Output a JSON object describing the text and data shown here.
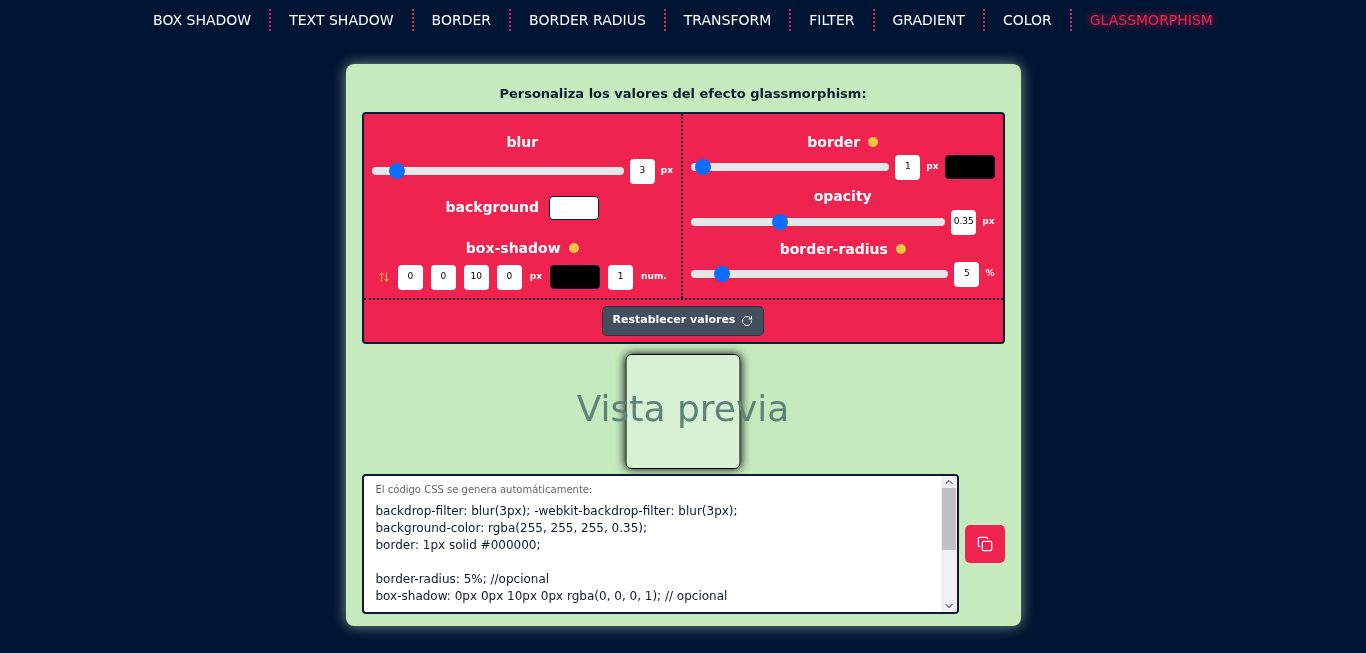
{
  "nav": [
    {
      "label": "BOX SHADOW",
      "selected": false
    },
    {
      "label": "TEXT SHADOW",
      "selected": false
    },
    {
      "label": "BORDER",
      "selected": false
    },
    {
      "label": "BORDER RADIUS",
      "selected": false
    },
    {
      "label": "TRANSFORM",
      "selected": false
    },
    {
      "label": "FILTER",
      "selected": false
    },
    {
      "label": "GRADIENT",
      "selected": false
    },
    {
      "label": "COLOR",
      "selected": false
    },
    {
      "label": "GLASSMORPHISM",
      "selected": true
    }
  ],
  "heading": "Personaliza los valores del efecto glassmorphism:",
  "blur": {
    "label": "blur",
    "level": 0.1,
    "value": "3",
    "unit": "px"
  },
  "background": {
    "label": "background",
    "color": "#ffffff"
  },
  "box_shadow": {
    "label": "box-shadow",
    "values": [
      "0",
      "0",
      "10",
      "0"
    ],
    "unit": "px",
    "color": "#000000",
    "opacity": "1",
    "opacity_unit": "num."
  },
  "border": {
    "label": "border",
    "level": 0.06,
    "value": "1",
    "unit": "px",
    "color": "#000000"
  },
  "opacity": {
    "label": "opacity",
    "level": 0.35,
    "value": "0.35",
    "unit": "px"
  },
  "border_radius": {
    "label": "border-radius",
    "level": 0.12,
    "value": "5",
    "unit": "%"
  },
  "reset_button": "Restablecer valores",
  "preview_text": "Vista previa",
  "code": {
    "label": "El código CSS se genera automáticamente:",
    "blocks": [
      [
        "backdrop-filter: blur(3px); -webkit-backdrop-filter: blur(3px);",
        "background-color: rgba(255, 255, 255, 0.35);",
        "border: 1px solid #000000;"
      ],
      [
        "border-radius: 5%; //opcional",
        "box-shadow: 0px 0px 10px 0px rgba(0, 0, 0, 1); // opcional"
      ]
    ]
  }
}
